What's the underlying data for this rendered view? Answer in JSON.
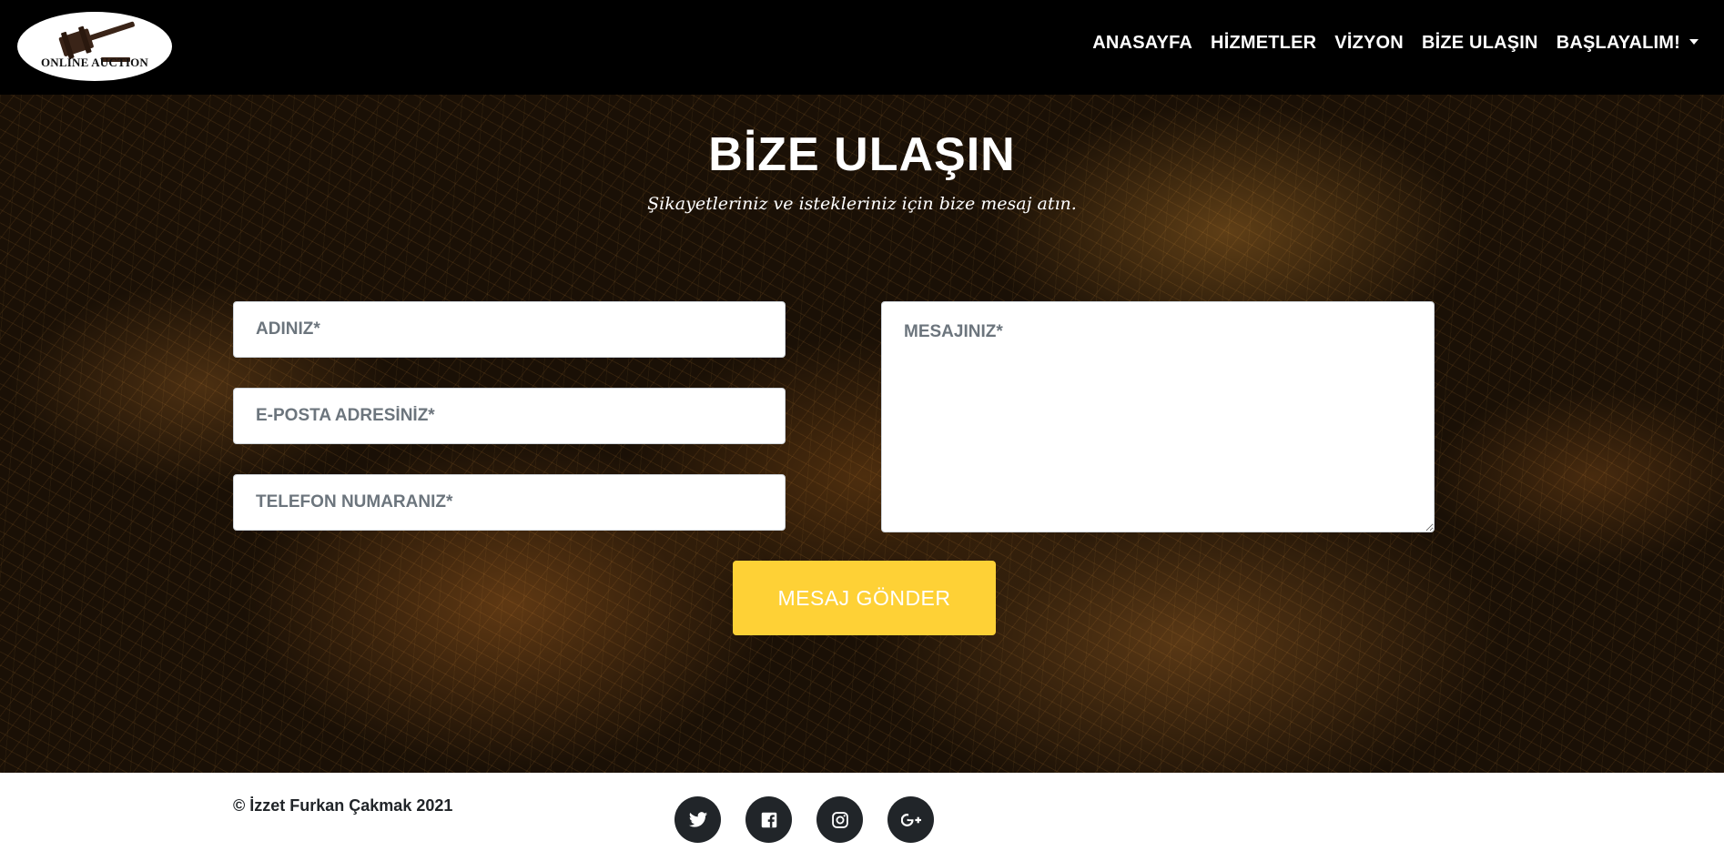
{
  "brand": {
    "logo_text": "ONLINE AUCTION",
    "logo_icon": "gavel-icon"
  },
  "nav": {
    "items": [
      {
        "label": "ANASAYFA"
      },
      {
        "label": "HİZMETLER"
      },
      {
        "label": "VİZYON"
      },
      {
        "label": "BİZE ULAŞIN"
      },
      {
        "label": "BAŞLAYALIM!",
        "dropdown": true
      }
    ]
  },
  "contact": {
    "title": "BİZE ULAŞIN",
    "subtitle": "Şikayetleriniz ve istekleriniz için bize mesaj atın.",
    "name_placeholder": "ADINIZ*",
    "email_placeholder": "E-POSTA ADRESİNİZ*",
    "phone_placeholder": "TELEFON NUMARANIZ*",
    "message_placeholder": "MESAJINIZ*",
    "submit_label": "MESAJ GÖNDER",
    "accent_color": "#fed136"
  },
  "footer": {
    "copyright": "© İzzet Furkan Çakmak 2021",
    "social": [
      "twitter-icon",
      "facebook-icon",
      "instagram-icon",
      "google-plus-icon"
    ]
  }
}
